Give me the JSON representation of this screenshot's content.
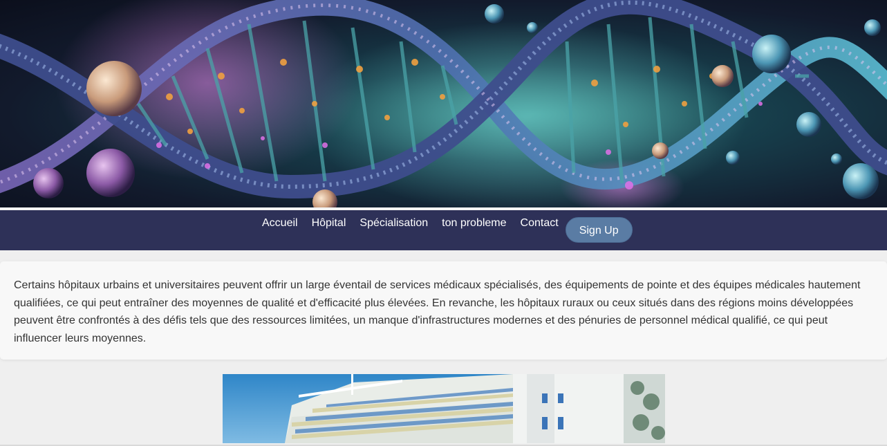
{
  "hero": {
    "image": "dna-double-helix-illustration"
  },
  "nav": {
    "items": [
      {
        "label": "Accueil"
      },
      {
        "label": "Hôpital"
      },
      {
        "label": "Spécialisation"
      },
      {
        "label": "ton probleme"
      },
      {
        "label": "Contact"
      }
    ],
    "signup_label": "Sign Up"
  },
  "content": {
    "paragraph": "Certains hôpitaux urbains et universitaires peuvent offrir un large éventail de services médicaux spécialisés, des équipements de pointe et des équipes médicales hautement qualifiées, ce qui peut entraîner des moyennes de qualité et d'efficacité plus élevées. En revanche, les hôpitaux ruraux ou ceux situés dans des régions moins développées peuvent être confrontés à des défis tels que des ressources limitées, un manque d'infrastructures modernes et des pénuries de personnel médical qualifié, ce qui peut influencer leurs moyennes."
  },
  "photo": {
    "image": "hospital-building-photo"
  },
  "colors": {
    "navbar": "#2e3158",
    "signup_button": "#5a7ca4",
    "page_background": "#efefef",
    "card_background": "#f8f8f8"
  }
}
